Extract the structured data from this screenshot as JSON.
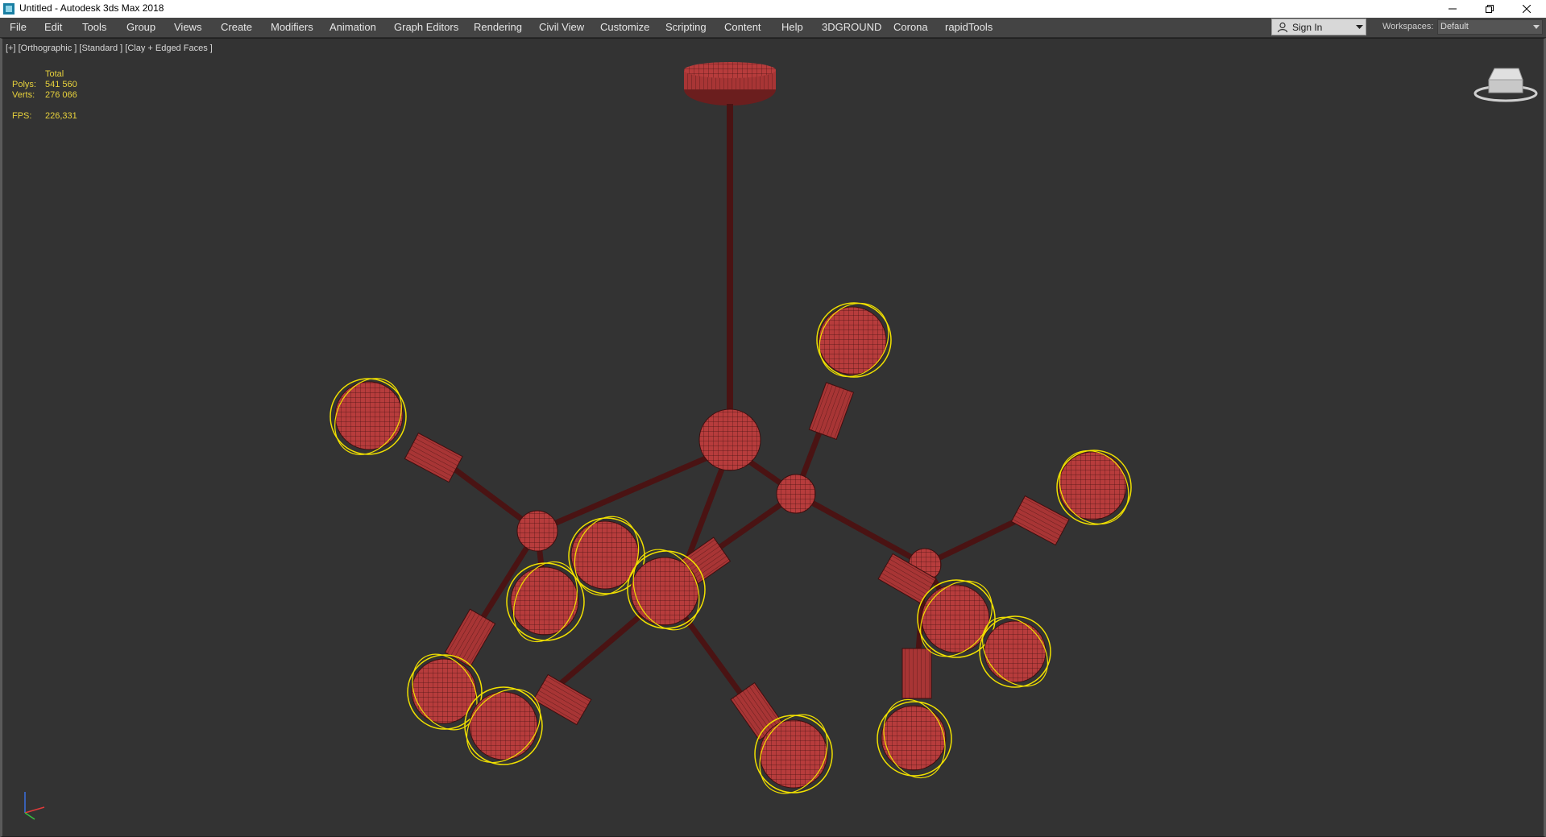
{
  "window": {
    "title": "Untitled - Autodesk 3ds Max 2018"
  },
  "menu": {
    "items": [
      {
        "label": "File",
        "name": "file"
      },
      {
        "label": "Edit",
        "name": "edit"
      },
      {
        "label": "Tools",
        "name": "tools"
      },
      {
        "label": "Group",
        "name": "group"
      },
      {
        "label": "Views",
        "name": "views"
      },
      {
        "label": "Create",
        "name": "create"
      },
      {
        "label": "Modifiers",
        "name": "modifiers"
      },
      {
        "label": "Animation",
        "name": "animation"
      },
      {
        "label": "Graph Editors",
        "name": "graph-editors"
      },
      {
        "label": "Rendering",
        "name": "rendering"
      },
      {
        "label": "Civil View",
        "name": "civil-view"
      },
      {
        "label": "Customize",
        "name": "customize"
      },
      {
        "label": "Scripting",
        "name": "scripting"
      },
      {
        "label": "Content",
        "name": "content"
      },
      {
        "label": "Help",
        "name": "help"
      },
      {
        "label": "3DGROUND",
        "name": "3dground"
      },
      {
        "label": "Corona",
        "name": "corona"
      },
      {
        "label": "rapidTools",
        "name": "rapidtools"
      }
    ]
  },
  "account": {
    "sign_in": "Sign In",
    "workspaces_label": "Workspaces:",
    "workspace_value": "Default"
  },
  "viewport": {
    "label": "[+] [Orthographic ] [Standard ] [Clay + Edged Faces ]",
    "stats": {
      "total_label": "Total",
      "polys_label": "Polys:",
      "polys_value": "541 560",
      "verts_label": "Verts:",
      "verts_value": "276 066",
      "fps_label": "FPS:",
      "fps_value": "226,331"
    }
  },
  "colors": {
    "menubar": "#444444",
    "viewport_bg": "#333333",
    "stats_text": "#e8d23c",
    "bulb_fill": "#b23a3a",
    "wire": "#3d0f0f",
    "selection": "#f0e000"
  },
  "icons": {
    "app": "3ds-max-icon",
    "minimize": "minimize-icon",
    "restore": "restore-icon",
    "close": "close-icon",
    "user": "user-icon",
    "dropdown": "chevron-down-icon",
    "viewcube": "viewcube-icon",
    "axis": "axis-tripod-icon"
  }
}
